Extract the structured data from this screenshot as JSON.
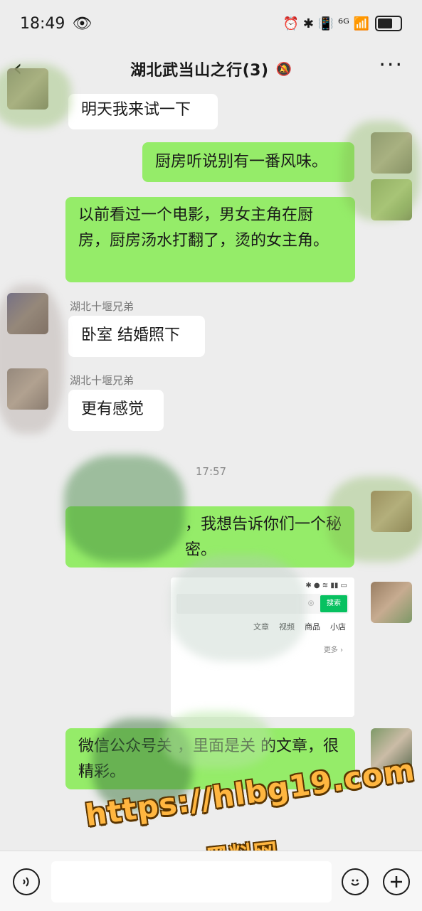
{
  "status_bar": {
    "time": "18:49",
    "eye_icon": "eye-icon",
    "indicators": "⏰ ✱ 📳 ⁶ᴳ 📶",
    "battery_icon": "battery-icon"
  },
  "header": {
    "title": "湖北武当山之行(3)",
    "back_icon": "‹",
    "mute_icon": "🔕",
    "more_icon": "···"
  },
  "messages": [
    {
      "side": "left",
      "text": "明天我来试一下"
    },
    {
      "side": "right",
      "text": "厨房听说别有一番风味。"
    },
    {
      "side": "right",
      "text": "以前看过一个电影，男女主角在厨房，厨房汤水打翻了，烫的女主角。"
    },
    {
      "side": "left",
      "sender": "湖北十堰兄弟",
      "text": "卧室 结婚照下"
    },
    {
      "side": "left",
      "sender": "湖北十堰兄弟",
      "text": "更有感觉"
    },
    {
      "type": "time",
      "text": "17:57"
    },
    {
      "side": "right",
      "text": "，我想告诉你们一个秘密。"
    },
    {
      "side": "right",
      "type": "image",
      "thumb": {
        "search_button": "搜索",
        "tabs": [
          "文章",
          "视频",
          "商品",
          "小店"
        ],
        "more": "更多 ›"
      }
    },
    {
      "side": "right",
      "text": "微信公众号关 ，里面是关 的文章，很精彩。"
    }
  ],
  "watermark": {
    "url": "https://hlbg19.com",
    "name": "黑料网"
  },
  "input_bar": {
    "voice_icon": "voice-icon",
    "emoji_icon": "emoji-icon",
    "plus_icon": "plus-icon",
    "placeholder": ""
  }
}
